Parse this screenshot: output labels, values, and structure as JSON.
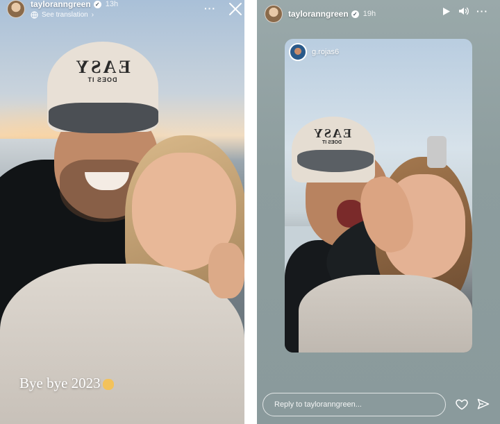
{
  "left_story": {
    "username": "tayloranngreen",
    "time": "13h",
    "see_translation": "See translation",
    "translation_chevron": "›",
    "more_label": "···",
    "caption_text": "Bye bye 2023",
    "cap_text": "EASY",
    "cap_subtext": "DOES IT"
  },
  "right_story": {
    "username": "tayloranngreen",
    "time": "19h",
    "more_label": "···",
    "reposted_from": "g.rojas6",
    "cap_text": "EASY",
    "cap_subtext": "DOES IT",
    "reply_placeholder": "Reply to tayloranngreen..."
  },
  "icons": {
    "verified": "verified-badge",
    "close": "close-icon",
    "play": "play-icon",
    "volume": "volume-icon",
    "heart": "heart-icon",
    "send": "send-icon",
    "more": "more-icon"
  },
  "colors": {
    "text_on_image": "#ffffff",
    "right_background": "#8d9d9e"
  }
}
